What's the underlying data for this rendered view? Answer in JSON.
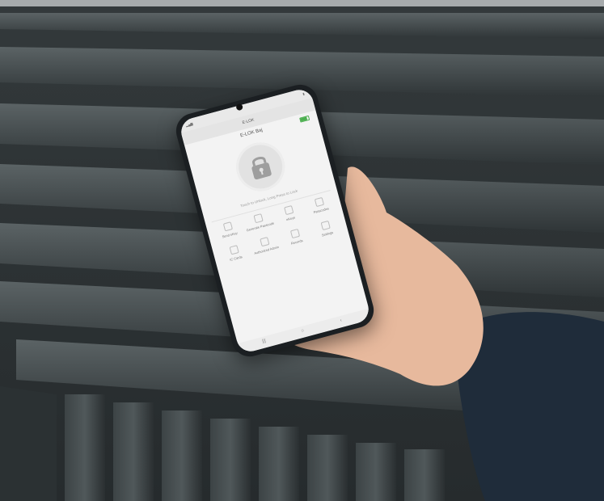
{
  "phone_screen": {
    "app_title": "E-LOK",
    "lock_name": "E-LOK Baj",
    "hint": "Touch to Unlock, Long Press to Lock",
    "menu": [
      {
        "label": "Send eKey",
        "icon": "key-icon"
      },
      {
        "label": "Generate Passcode",
        "icon": "passcode-icon"
      },
      {
        "label": "eKeys",
        "icon": "ekeys-icon"
      },
      {
        "label": "Passcodes",
        "icon": "list-icon"
      },
      {
        "label": "IC Cards",
        "icon": "card-icon"
      },
      {
        "label": "Authorized Admin",
        "icon": "admin-icon"
      },
      {
        "label": "Records",
        "icon": "records-icon"
      },
      {
        "label": "Settings",
        "icon": "gear-icon"
      }
    ]
  },
  "colors": {
    "background": "#2e3436",
    "slat": "#4a5254",
    "screen": "#f3f3f3",
    "skin": "#e7b99d",
    "sleeve": "#1f2c3a"
  }
}
